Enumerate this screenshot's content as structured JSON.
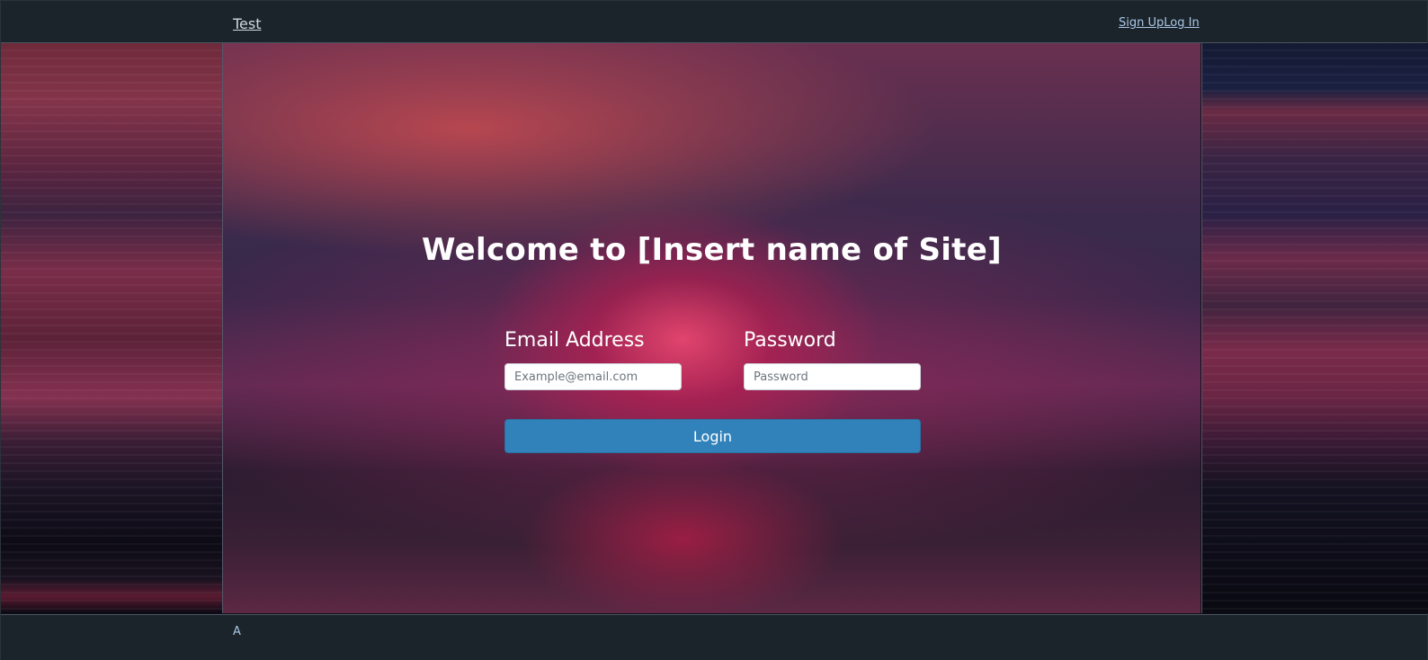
{
  "header": {
    "brand": "Test",
    "signup_label": "Sign Up",
    "login_label": "Log In"
  },
  "main": {
    "welcome_title": "Welcome to [Insert name of Site]",
    "email": {
      "label": "Email Address",
      "placeholder": "Example@email.com",
      "value": ""
    },
    "password": {
      "label": "Password",
      "placeholder": "Password",
      "value": ""
    },
    "login_button": "Login"
  },
  "footer": {
    "text": "A"
  },
  "colors": {
    "navbar_bg": "#1c242b",
    "link": "#a9c7e6",
    "button_primary": "#3182ba"
  }
}
